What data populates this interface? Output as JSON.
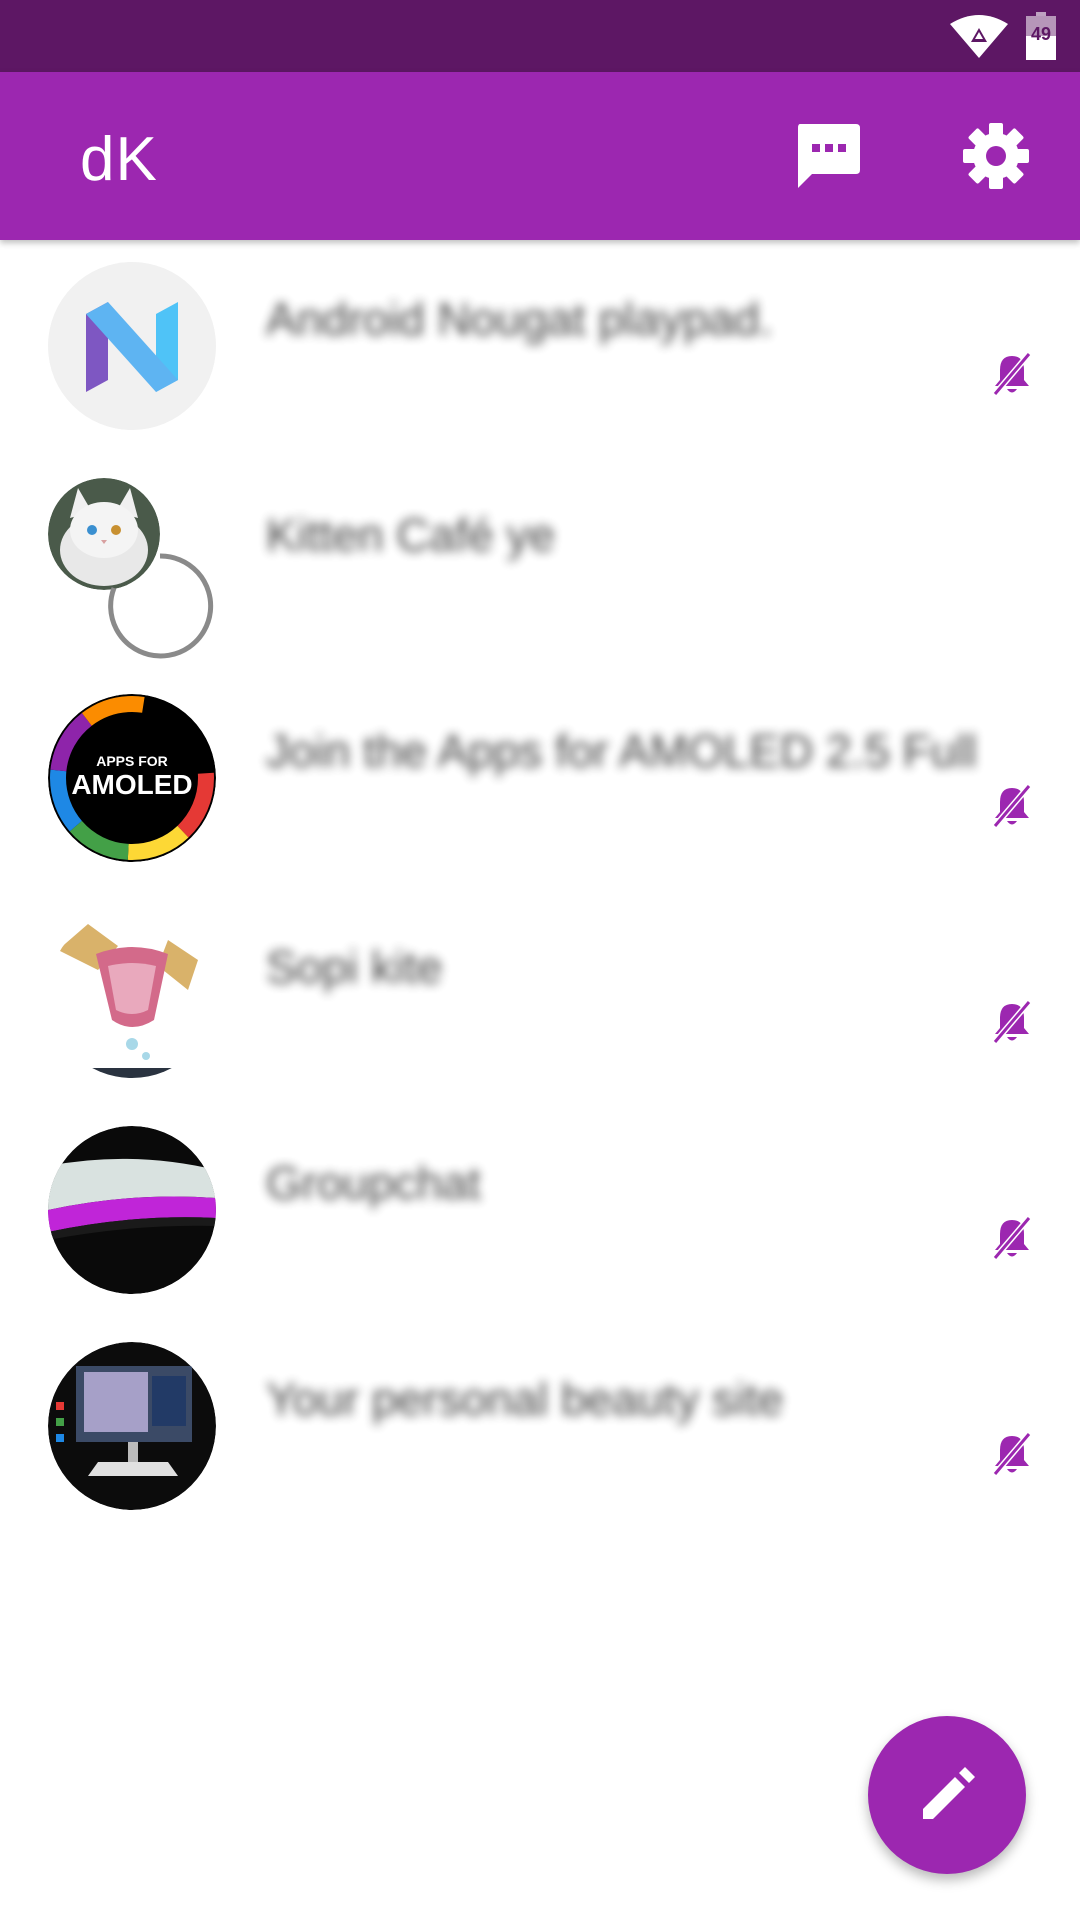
{
  "status_bar": {
    "battery_level": "49",
    "wifi_icon": "wifi-icon",
    "battery_icon": "battery-icon"
  },
  "toolbar": {
    "title": "dK",
    "chat_icon": "chat-bubble-icon",
    "settings_icon": "gear-icon"
  },
  "conversations": [
    {
      "title": "Android Nougat playpad.",
      "avatar": "android-n-logo",
      "muted": true
    },
    {
      "title": "Kitten Café ye",
      "avatar": "white-cat-photo",
      "muted": false,
      "loading": true
    },
    {
      "title": "Join the Apps for AMOLED 2.5 Full",
      "avatar": "apps-for-amoled-logo",
      "muted": true
    },
    {
      "title": "Sopi kite",
      "avatar": "drawing-image",
      "muted": true
    },
    {
      "title": "Groupchat",
      "avatar": "phone-screen-photo",
      "muted": true
    },
    {
      "title": "Your personal beauty site",
      "avatar": "monitor-photo",
      "muted": true
    }
  ],
  "fab": {
    "icon": "pencil-icon"
  },
  "colors": {
    "status_bar": "#5d1764",
    "primary": "#9c27b0",
    "accent_mute": "#9c27b0"
  }
}
